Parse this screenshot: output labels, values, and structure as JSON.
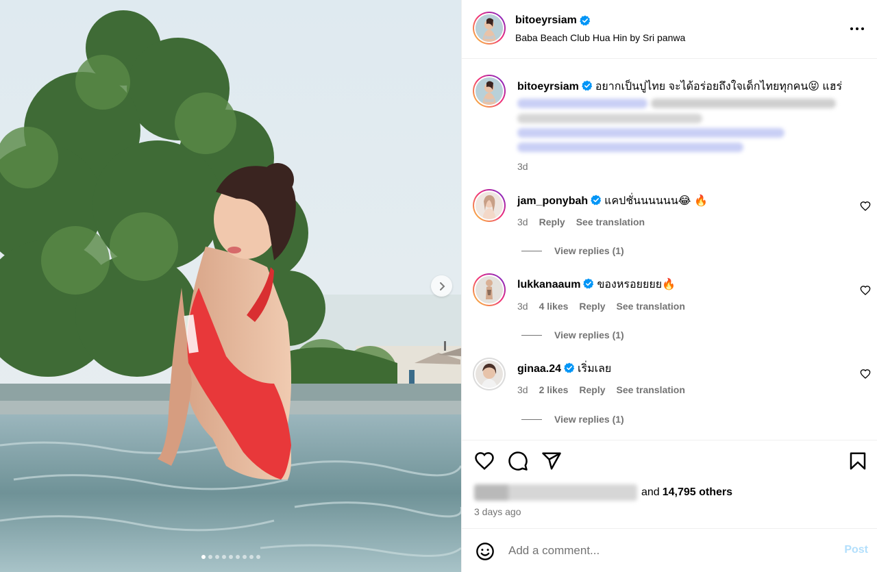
{
  "colors": {
    "accent": "#0095f6",
    "verified": "#0095f6",
    "muted": "#737373",
    "post_disabled": "#b2dffc",
    "divider": "#efefef"
  },
  "media": {
    "carousel_total": 9,
    "carousel_active": 1,
    "next_icon": "chevron-right-icon"
  },
  "header": {
    "username": "bitoeyrsiam",
    "location": "Baba Beach Club Hua Hin by Sri panwa",
    "more_icon": "more-horizontal-icon"
  },
  "caption": {
    "username": "bitoeyrsiam",
    "text": "อยากเป็นปูไทย จะได้อร่อยถึงใจเด็กไทยทุกคน😝 แฮร่",
    "time": "3d"
  },
  "comments": [
    {
      "username": "jam_ponybah",
      "text": "แคปชั่นนนนนน😂 🔥",
      "time": "3d",
      "likes": "",
      "reply": "Reply",
      "translate": "See translation",
      "view_replies": "View replies (1)"
    },
    {
      "username": "lukkanaaum",
      "text": "ของหรอยยยย🔥",
      "time": "3d",
      "likes": "4 likes",
      "reply": "Reply",
      "translate": "See translation",
      "view_replies": "View replies (1)"
    },
    {
      "username": "ginaa.24",
      "text": "เริ่มเลย",
      "time": "3d",
      "likes": "2 likes",
      "reply": "Reply",
      "translate": "See translation",
      "view_replies": "View replies (1)"
    }
  ],
  "likes": {
    "and_text": "and",
    "count_text": "14,795 others"
  },
  "posted": "3 days ago",
  "add_comment": {
    "placeholder": "Add a comment...",
    "post_label": "Post"
  }
}
